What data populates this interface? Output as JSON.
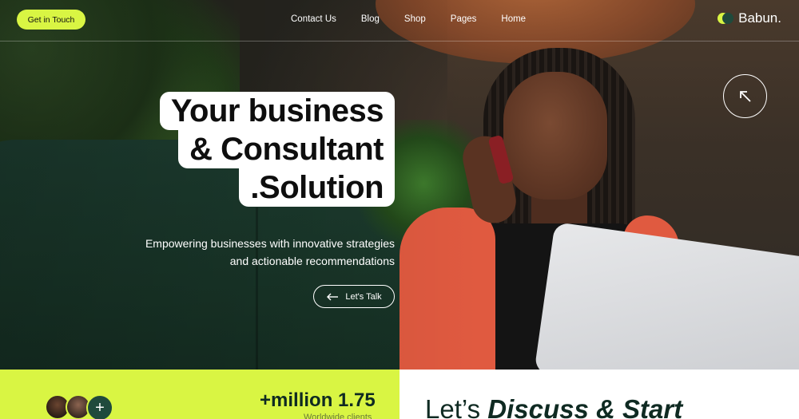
{
  "nav": {
    "cta_label": "Get in Touch",
    "links": [
      "Contact Us",
      "Blog",
      "Shop",
      "Pages",
      "Home"
    ],
    "brand": "Babun."
  },
  "hero": {
    "headline": [
      "Your business",
      "& Consultant",
      ".Solution"
    ],
    "subtitle": [
      "Empowering businesses with innovative strategies",
      "and actionable recommendations"
    ],
    "talk_label": "Let's Talk",
    "arrow_icon": "arrow-up-left-icon"
  },
  "stats": {
    "value": "+million 1.75",
    "label": "Worldwide clients",
    "add_icon": "plus-icon"
  },
  "section": {
    "title_plain": "Let’s ",
    "title_emph": "Discuss & Start"
  },
  "colors": {
    "accent": "#d9f543",
    "dark_green": "#1f4a3c"
  }
}
